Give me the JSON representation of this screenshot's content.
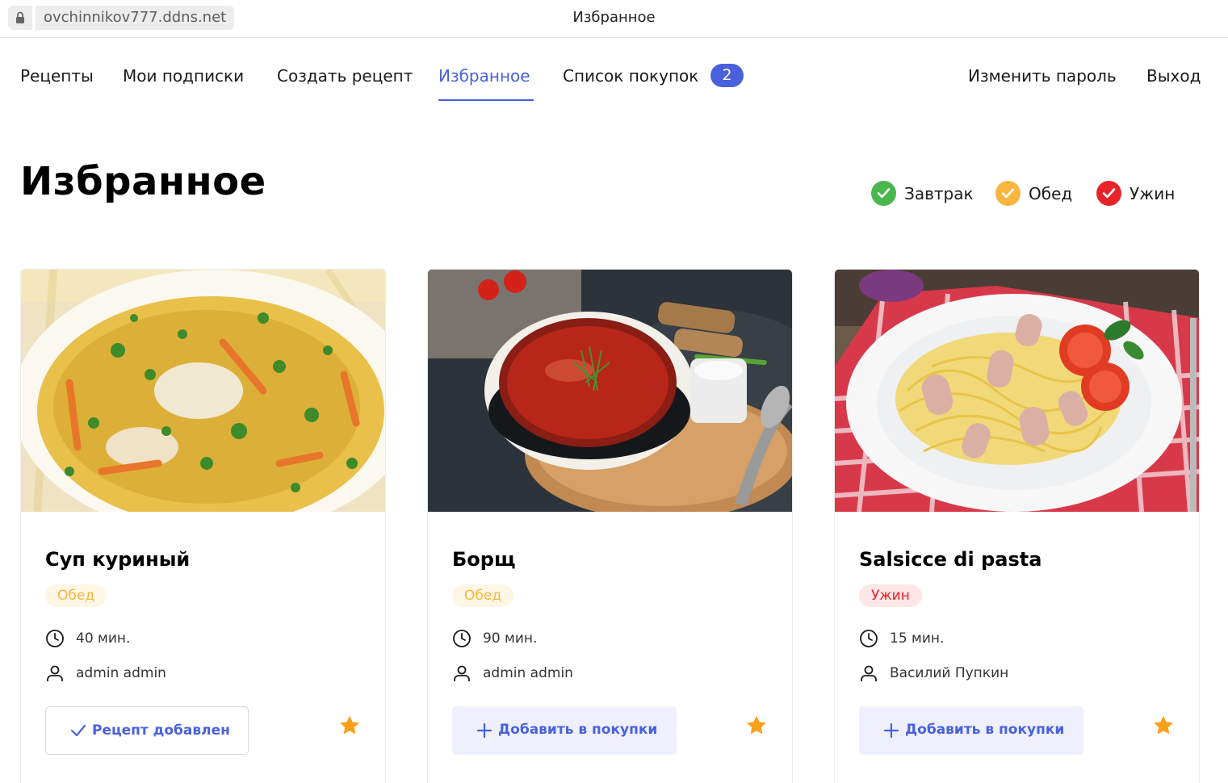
{
  "browser": {
    "url": "ovchinnikov777.ddns.net",
    "window_title": "Избранное"
  },
  "nav": {
    "recipes": "Рецепты",
    "subscriptions": "Мои подписки",
    "create": "Создать рецепт",
    "favorites": "Избранное",
    "shopping_list": "Список покупок",
    "shopping_count": "2",
    "change_password": "Изменить пароль",
    "logout": "Выход"
  },
  "page": {
    "title": "Избранное"
  },
  "filters": [
    {
      "label": "Завтрак",
      "color": "#49b64e",
      "checked": true
    },
    {
      "label": "Обед",
      "color": "#f9b53d",
      "checked": true
    },
    {
      "label": "Ужин",
      "color": "#e8242a",
      "checked": true
    }
  ],
  "cards": [
    {
      "title": "Суп куриный",
      "tag": "Обед",
      "time": "40 мин.",
      "author": "admin admin",
      "button": "Рецепт добавлен",
      "favorited": true
    },
    {
      "title": "Борщ",
      "tag": "Обед",
      "time": "90 мин.",
      "author": "admin admin",
      "button": "Добавить в покупки",
      "favorited": true
    },
    {
      "title": "Salsicce di pasta",
      "tag": "Ужин",
      "time": "15 мин.",
      "author": "Василий Пупкин",
      "button": "Добавить в покупки",
      "favorited": true
    }
  ],
  "colors": {
    "accent": "#4a61dd",
    "star": "#f9a01b",
    "lunch_tag": "#f9b53d",
    "dinner_tag": "#e8242a"
  }
}
